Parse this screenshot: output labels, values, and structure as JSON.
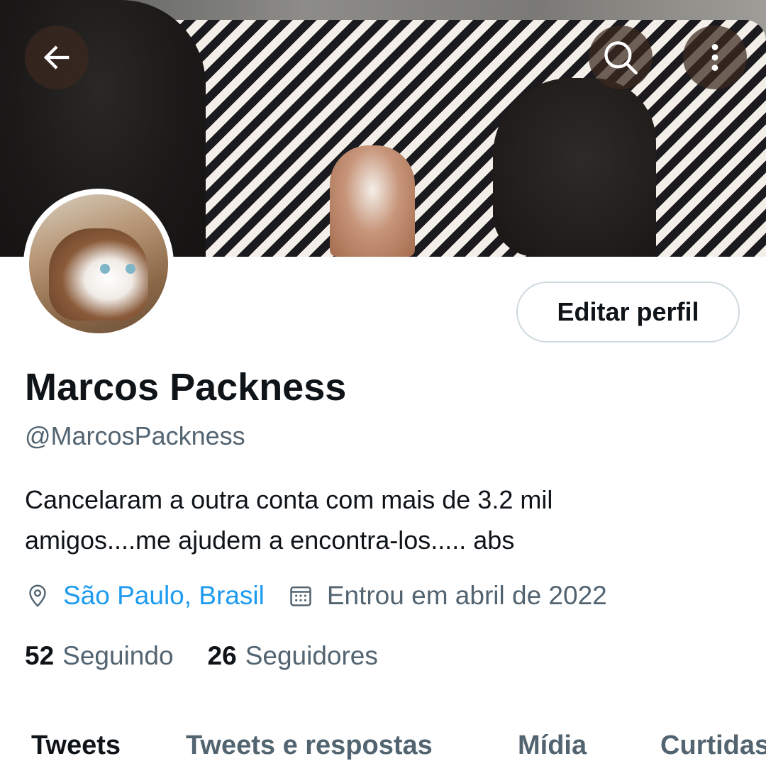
{
  "header": {
    "back_icon": "arrow-left-icon",
    "search_icon": "search-icon",
    "more_icon": "more-vertical-icon"
  },
  "profile": {
    "edit_button_label": "Editar perfil",
    "name": "Marcos Packness",
    "handle": "@MarcosPackness",
    "bio_line1": "Cancelaram a outra conta com mais de 3.2 mil",
    "bio_line2": "amigos....me ajudem a encontra-los..... abs",
    "location": "São Paulo, Brasil",
    "location_icon": "location-pin-icon",
    "joined": "Entrou em abril de 2022",
    "joined_icon": "calendar-icon",
    "following_count": "52",
    "following_label": "Seguindo",
    "followers_count": "26",
    "followers_label": "Seguidores"
  },
  "tabs": [
    {
      "label": "Tweets",
      "active": true
    },
    {
      "label": "Tweets e respostas",
      "active": false
    },
    {
      "label": "Mídia",
      "active": false
    },
    {
      "label": "Curtidas",
      "active": false
    }
  ],
  "colors": {
    "accent": "#1d9bf0",
    "text_primary": "#0f1419",
    "text_secondary": "#536471",
    "border": "#cfd9de"
  }
}
